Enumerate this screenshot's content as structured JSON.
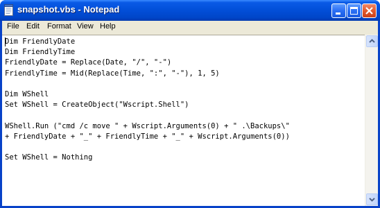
{
  "window": {
    "title": "snapshot.vbs - Notepad",
    "icon": "notepad-document-icon",
    "controls": {
      "minimize": "minimize-icon",
      "maximize": "maximize-icon",
      "close": "close-icon"
    }
  },
  "menu": {
    "items": [
      {
        "label": "File"
      },
      {
        "label": "Edit"
      },
      {
        "label": "Format"
      },
      {
        "label": "View"
      },
      {
        "label": "Help"
      }
    ]
  },
  "editor": {
    "text": "Dim FriendlyDate\nDim FriendlyTime\nFriendlyDate = Replace(Date, \"/\", \"-\")\nFriendlyTime = Mid(Replace(Time, \":\", \"-\"), 1, 5)\n\nDim WShell\nSet WShell = CreateObject(\"Wscript.Shell\")\n\nWShell.Run (\"cmd /c move \" + Wscript.Arguments(0) + \" .\\Backups\\\"\n+ FriendlyDate + \"_\" + FriendlyTime + \"_\" + Wscript.Arguments(0))\n\nSet WShell = Nothing"
  },
  "scrollbar": {
    "up": "scroll-up-arrow-icon",
    "down": "scroll-down-arrow-icon"
  },
  "colors": {
    "titlebar": "#0250da",
    "menubar": "#ece9d8",
    "close_button": "#e35a2c"
  }
}
